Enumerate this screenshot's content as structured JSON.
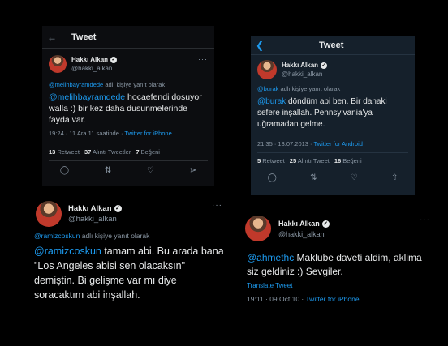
{
  "panel1": {
    "header_title": "Tweet",
    "name": "Hakkı Alkan",
    "handle": "@hakki_alkan",
    "reply_mention": "@melihbayramdede",
    "reply_text": "adlı kişiye yanıt olarak",
    "mention": "@melihbayramdede",
    "body": " hocaefendi dosuyor walla :) bir kez daha dusunmelerinde fayda var.",
    "time": "19:24 · 11 Ara 11 saatinde · ",
    "source": "Twitter for iPhone",
    "retweets": "13",
    "retweets_label": "Retweet",
    "quotes": "37",
    "quotes_label": "Alıntı Tweetler",
    "likes": "7",
    "likes_label": "Beğeni"
  },
  "panel2": {
    "header_title": "Tweet",
    "name": "Hakkı Alkan",
    "handle": "@hakki_alkan",
    "reply_mention": "@burak",
    "reply_text": "adlı kişiye yanıt olarak",
    "mention": "@burak",
    "body": " döndüm abi ben. Bir dahaki sefere inşallah. Pennsylvania'ya uğramadan gelme.",
    "time": "21:35 · 13.07.2013 · ",
    "source": "Twitter for Android",
    "retweets": "5",
    "retweets_label": "Retweet",
    "quotes": "25",
    "quotes_label": "Alıntı Tweet",
    "likes": "16",
    "likes_label": "Beğeni"
  },
  "panel3": {
    "name": "Hakkı Alkan",
    "handle": "@hakki_alkan",
    "reply_mention": "@ramizcoskun",
    "reply_text": "adlı kişiye yanıt olarak",
    "mention": "@ramizcoskun",
    "body": " tamam abi. Bu arada bana \"Los Angeles abisi sen olacaksın\" demiştin. Bi gelişme var mı diye soracaktım abi inşallah."
  },
  "panel4": {
    "name": "Hakkı Alkan",
    "handle": "@hakki_alkan",
    "mention": "@ahmethc",
    "body": " Maklube daveti aldim, aklima siz geldiniz :) Sevgiler.",
    "translate": "Translate Tweet",
    "time": "19:11 · 09 Oct 10 · ",
    "source": "Twitter for iPhone"
  },
  "icons": {
    "back": "back-arrow-icon",
    "verified": "verified-badge-icon",
    "more": "more-options-icon",
    "reply": "reply-icon",
    "retweet": "retweet-icon",
    "like": "like-icon",
    "share": "share-icon"
  },
  "colors": {
    "background": "#000000",
    "dim_panel": "#15202b",
    "link": "#1d9bf0",
    "muted": "#8b98a5",
    "text": "#e7e9ea"
  }
}
